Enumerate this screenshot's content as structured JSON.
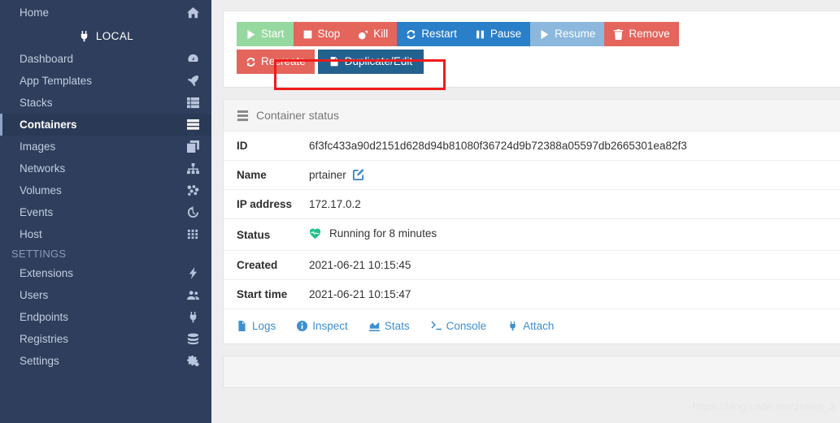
{
  "sidebar": {
    "home": {
      "label": "Home",
      "icon": "home-icon"
    },
    "endpoint": {
      "label": "LOCAL",
      "icon": "plug-icon"
    },
    "items": [
      {
        "label": "Dashboard",
        "icon": "dashboard-icon",
        "active": false
      },
      {
        "label": "App Templates",
        "icon": "rocket-icon",
        "active": false
      },
      {
        "label": "Stacks",
        "icon": "stacks-icon",
        "active": false
      },
      {
        "label": "Containers",
        "icon": "containers-icon",
        "active": true
      },
      {
        "label": "Images",
        "icon": "images-icon",
        "active": false
      },
      {
        "label": "Networks",
        "icon": "networks-icon",
        "active": false
      },
      {
        "label": "Volumes",
        "icon": "volumes-icon",
        "active": false
      },
      {
        "label": "Events",
        "icon": "history-icon",
        "active": false
      },
      {
        "label": "Host",
        "icon": "grid-icon",
        "active": false
      }
    ],
    "settings_title": "SETTINGS",
    "settings_items": [
      {
        "label": "Extensions",
        "icon": "bolt-icon"
      },
      {
        "label": "Users",
        "icon": "users-icon"
      },
      {
        "label": "Endpoints",
        "icon": "plug-icon"
      },
      {
        "label": "Registries",
        "icon": "database-icon"
      },
      {
        "label": "Settings",
        "icon": "gears-icon"
      }
    ]
  },
  "actions": {
    "buttons": [
      {
        "label": "Start",
        "icon": "play-icon",
        "color": "#96d9a0"
      },
      {
        "label": "Stop",
        "icon": "square-icon",
        "color": "#e4655c"
      },
      {
        "label": "Kill",
        "icon": "bomb-icon",
        "color": "#e4655c"
      },
      {
        "label": "Restart",
        "icon": "refresh-icon",
        "color": "#2a7fc9"
      },
      {
        "label": "Pause",
        "icon": "pause-icon",
        "color": "#2a7fc9"
      },
      {
        "label": "Resume",
        "icon": "play-icon",
        "color": "#8cb8dd"
      },
      {
        "label": "Remove",
        "icon": "trash-icon",
        "color": "#e4655c"
      }
    ],
    "buttons_row2": [
      {
        "label": "Recreate",
        "icon": "refresh-icon",
        "color": "#e4655c"
      },
      {
        "label": "Duplicate/Edit",
        "icon": "copy-icon",
        "color": "#23618f"
      }
    ],
    "highlight_color": "#f01b1b"
  },
  "status_panel": {
    "title": "Container status",
    "icon": "server-icon",
    "rows": [
      {
        "key": "ID",
        "value": "6f3fc433a90d2151d628d94b81080f36724d9b72388a05597db2665301ea82f3",
        "icon": ""
      },
      {
        "key": "Name",
        "value": "prtainer",
        "icon": "edit-icon"
      },
      {
        "key": "IP address",
        "value": "172.17.0.2",
        "icon": ""
      },
      {
        "key": "Status",
        "value": "Running for 8 minutes",
        "icon": "heartbeat-icon"
      },
      {
        "key": "Created",
        "value": "2021-06-21 10:15:45",
        "icon": ""
      },
      {
        "key": "Start time",
        "value": "2021-06-21 10:15:47",
        "icon": ""
      }
    ],
    "links": [
      {
        "label": "Logs",
        "icon": "file-icon"
      },
      {
        "label": "Inspect",
        "icon": "info-icon"
      },
      {
        "label": "Stats",
        "icon": "chart-icon"
      },
      {
        "label": "Console",
        "icon": "terminal-icon"
      },
      {
        "label": "Attach",
        "icon": "plug-icon"
      }
    ]
  },
  "watermark": {
    "text": "https://blog.csdn.net/zetion_3"
  }
}
